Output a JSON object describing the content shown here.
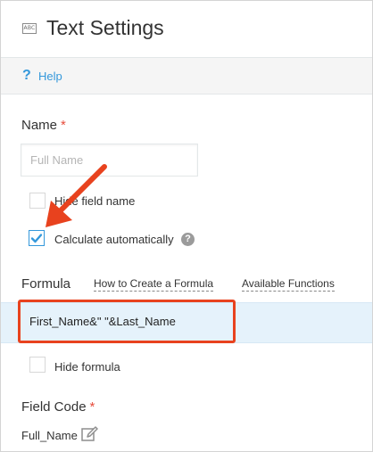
{
  "header": {
    "icon_text": "ABC",
    "title": "Text Settings"
  },
  "help": {
    "icon_glyph": "?",
    "label": "Help"
  },
  "name_field": {
    "label": "Name",
    "required_mark": "*",
    "placeholder": "Full Name"
  },
  "hide_field_name": {
    "label": "Hide field name",
    "checked": false
  },
  "calculate_automatically": {
    "label": "Calculate automatically",
    "checked": true,
    "info_glyph": "?"
  },
  "formula": {
    "label": "Formula",
    "links": [
      "How to Create a Formula",
      "Available Functions"
    ],
    "value": "First_Name&\" \"&Last_Name"
  },
  "hide_formula": {
    "label": "Hide formula",
    "checked": false
  },
  "field_code": {
    "label": "Field Code",
    "required_mark": "*",
    "value": "Full_Name"
  },
  "colors": {
    "accent": "#3498db",
    "required": "#e74c3c",
    "annotation": "#e8421e",
    "formula_bg": "#e5f2fb"
  },
  "icons": [
    "abc-text-field-icon",
    "help-icon",
    "checkmark-icon",
    "info-icon",
    "edit-pencil-icon",
    "annotation-arrow"
  ]
}
